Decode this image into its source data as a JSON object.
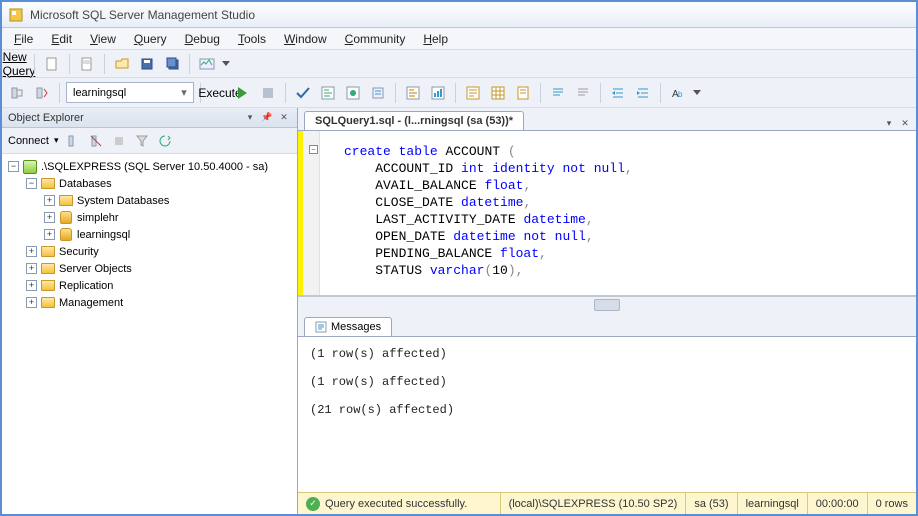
{
  "window": {
    "title": "Microsoft SQL Server Management Studio"
  },
  "menu": {
    "file": "File",
    "edit": "Edit",
    "view": "View",
    "query": "Query",
    "debug": "Debug",
    "tools": "Tools",
    "window": "Window",
    "community": "Community",
    "help": "Help"
  },
  "toolbar": {
    "new_query": "New Query",
    "database": "learningsql",
    "execute": "Execute"
  },
  "object_explorer": {
    "title": "Object Explorer",
    "connect": "Connect",
    "root": ".\\SQLEXPRESS (SQL Server 10.50.4000 - sa)",
    "databases": "Databases",
    "system_db": "System Databases",
    "db1": "simplehr",
    "db2": "learningsql",
    "security": "Security",
    "server_objects": "Server Objects",
    "replication": "Replication",
    "management": "Management"
  },
  "editor": {
    "tab": "SQLQuery1.sql - (l...rningsql (sa (53))*",
    "code": "create table ACCOUNT (\n    ACCOUNT_ID int identity not null,\n    AVAIL_BALANCE float,\n    CLOSE_DATE datetime,\n    LAST_ACTIVITY_DATE datetime,\n    OPEN_DATE datetime not null,\n    PENDING_BALANCE float,\n    STATUS varchar(10),"
  },
  "messages": {
    "tab": "Messages",
    "body": "(1 row(s) affected)\n\n(1 row(s) affected)\n\n(21 row(s) affected)"
  },
  "status": {
    "msg": "Query executed successfully.",
    "server": "(local)\\SQLEXPRESS (10.50 SP2)",
    "user": "sa (53)",
    "db": "learningsql",
    "time": "00:00:00",
    "rows": "0 rows"
  }
}
